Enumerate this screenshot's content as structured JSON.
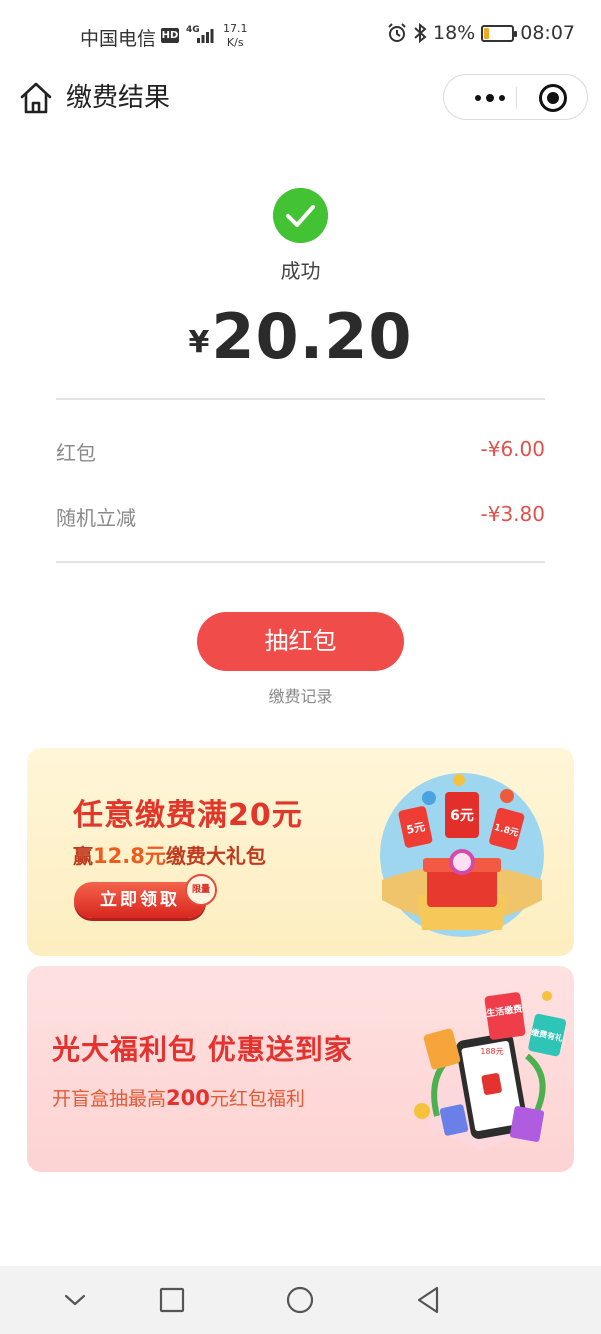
{
  "status_bar": {
    "carrier": "中国电信",
    "hd": "HD",
    "net_type": "4G",
    "net_speed_value": "17.1",
    "net_speed_unit": "K/s",
    "battery_text": "18%",
    "battery_level": 0.18,
    "time": "08:07"
  },
  "nav": {
    "title": "缴费结果"
  },
  "result": {
    "status_label": "成功",
    "currency": "¥",
    "amount": "20.20"
  },
  "details": [
    {
      "label": "红包",
      "value": "-¥6.00"
    },
    {
      "label": "随机立减",
      "value": "-¥3.80"
    }
  ],
  "actions": {
    "lottery_label": "抽红包",
    "record_link": "缴费记录"
  },
  "banner1": {
    "title": "任意缴费满20元",
    "sub_prefix": "赢",
    "sub_highlight": "12.8元",
    "sub_suffix": "缴费大礼包",
    "button": "立即领取",
    "limit_badge": "限量",
    "art_coupon_1": "5元",
    "art_coupon_2": "6元",
    "art_coupon_3": "1.8元"
  },
  "banner2": {
    "title": "光大福利包 优惠送到家",
    "sub_prefix": "开盲盒抽最高",
    "sub_highlight": "200",
    "sub_suffix": "元红包福利",
    "art_tag_1": "生活缴费",
    "art_tag_2": "缴费有礼",
    "art_tag_3": "188元"
  },
  "colors": {
    "success": "#43c234",
    "accent_red": "#ef4c4a",
    "discount_red": "#e0514c",
    "battery": "#f5a623"
  }
}
